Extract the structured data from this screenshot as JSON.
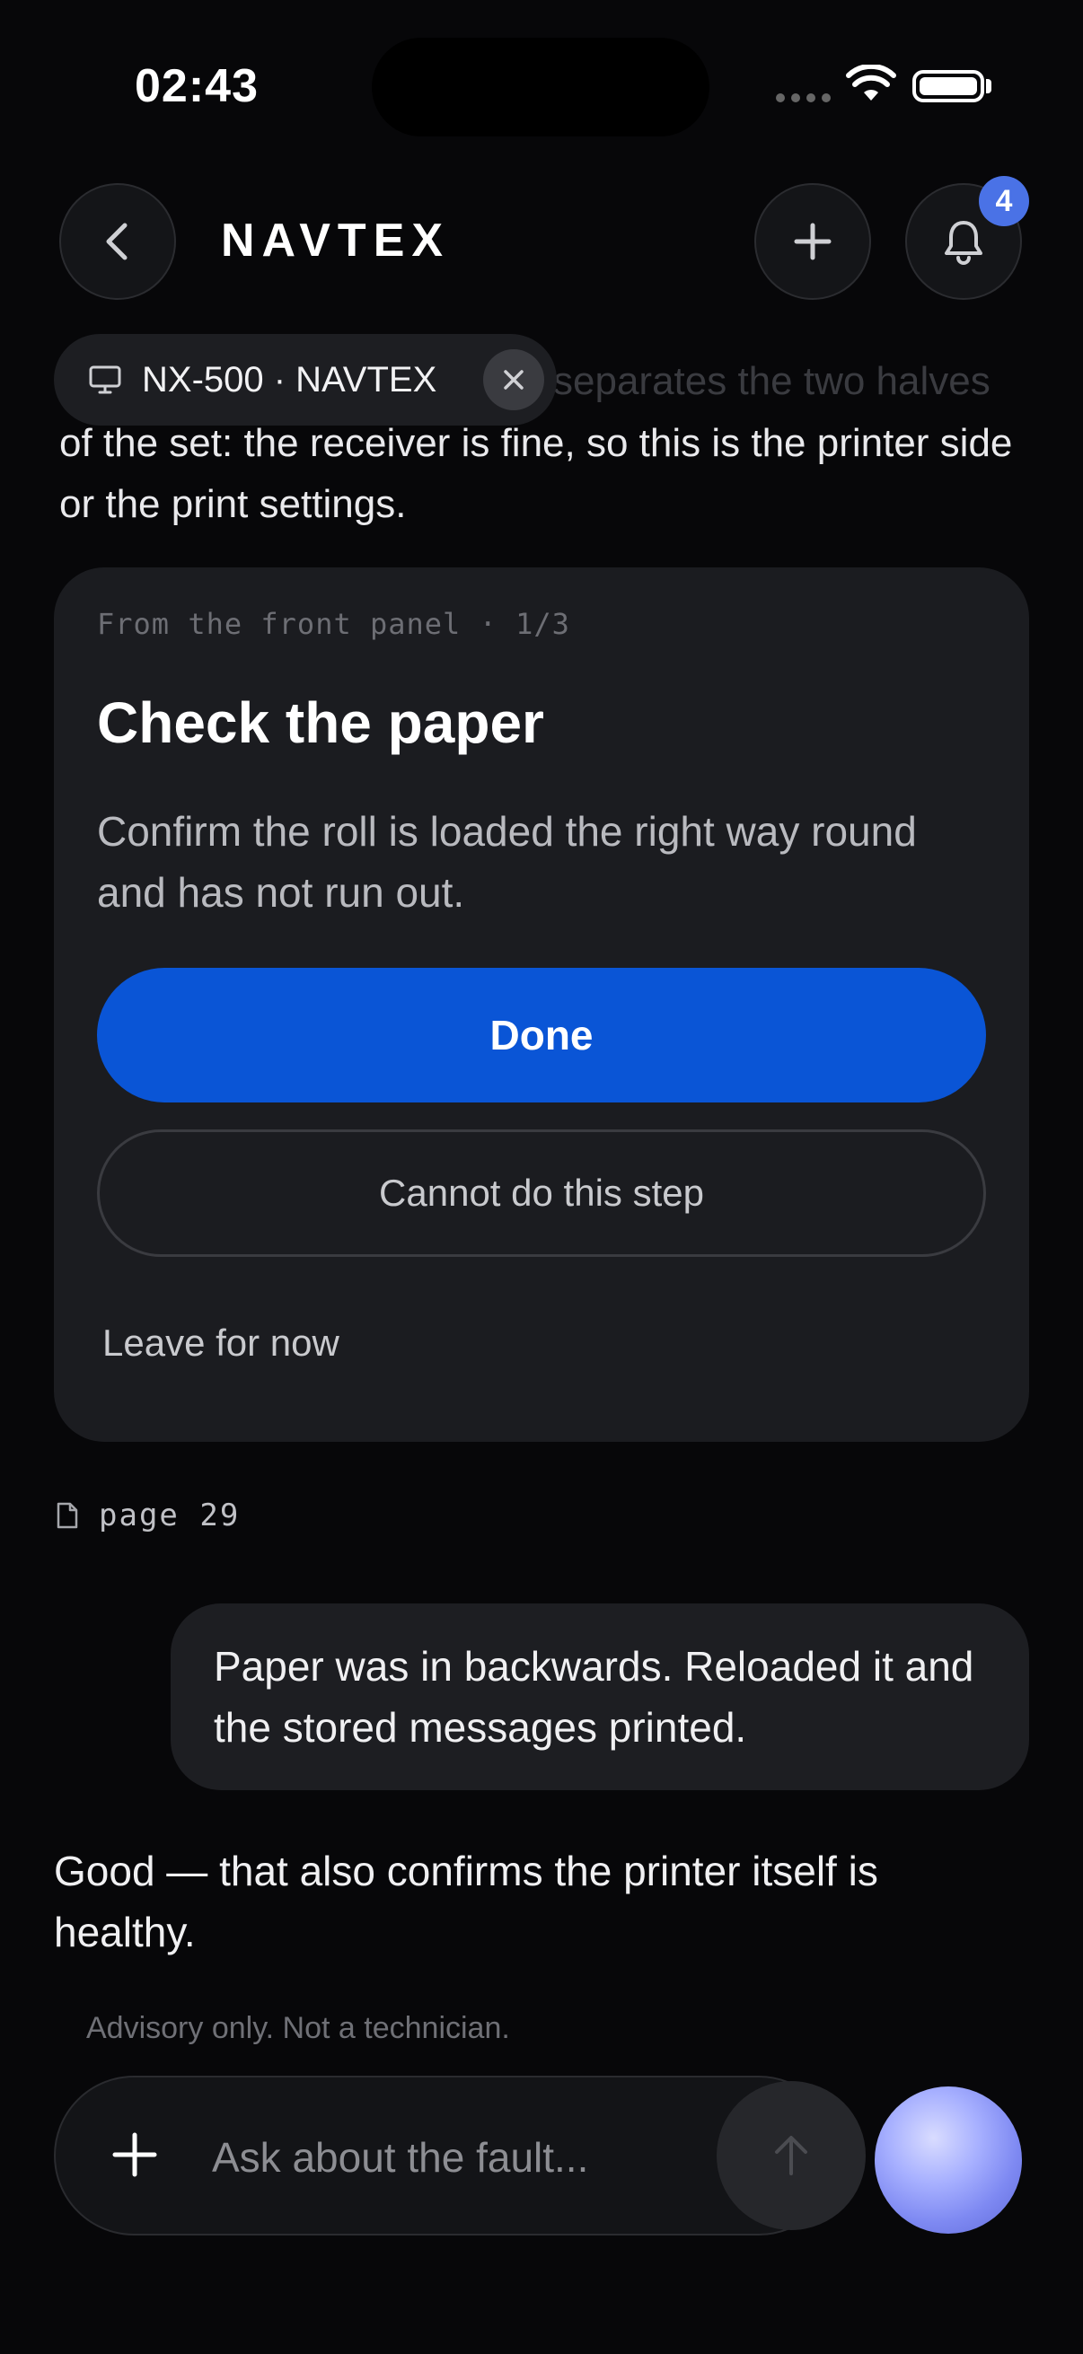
{
  "status_bar": {
    "time": "02:43"
  },
  "header": {
    "title": "NAVTEX",
    "notification_count": "4"
  },
  "chat": {
    "faded_text": "separates the two halves",
    "intro_text": "of the set: the receiver is fine, so this is the printer side or the print settings.",
    "device_chip": {
      "label": "NX-500 · NAVTEX"
    },
    "step_card": {
      "step_label": "From the front panel · 1/3",
      "title": "Check the paper",
      "body": "Confirm the roll is loaded the right way round and has not run out.",
      "done_label": "Done",
      "cannot_label": "Cannot do this step",
      "leave_label": "Leave for now"
    },
    "page_ref": "page 29",
    "user_message": "Paper was in backwards. Reloaded it and the stored messages printed.",
    "assistant_reply": "Good — that also confirms the printer itself is healthy.",
    "disclaimer": "Advisory only. Not a technician."
  },
  "composer": {
    "placeholder": "Ask about the fault..."
  },
  "colors": {
    "accent": "#0a55d6",
    "badge": "#4a72e6",
    "background": "#070709",
    "card": "#1b1c20"
  },
  "icons": [
    "back-chevron-icon",
    "plus-icon",
    "bell-icon",
    "monitor-icon",
    "close-icon",
    "document-icon",
    "send-arrow-icon",
    "assistant-orb"
  ]
}
